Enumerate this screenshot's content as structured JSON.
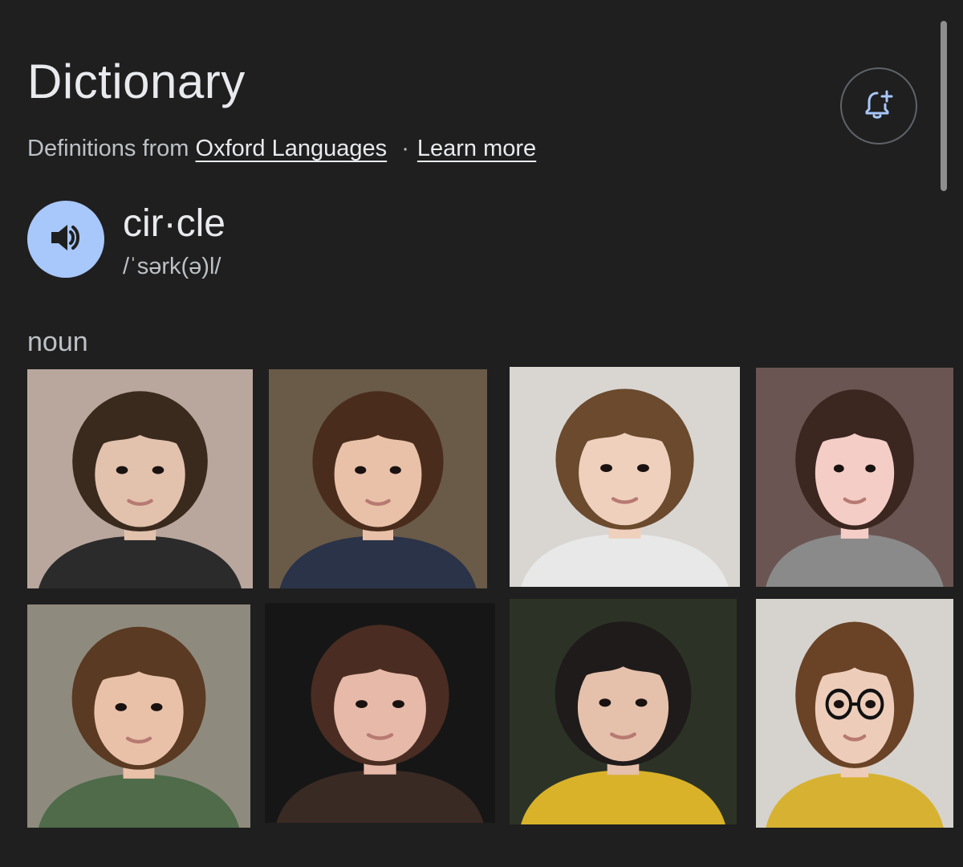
{
  "header": {
    "title": "Dictionary",
    "source_prefix": "Definitions from",
    "source_link": "Oxford Languages",
    "separator": "·",
    "learn_more": "Learn more",
    "alert_icon": "bell-plus-icon"
  },
  "entry": {
    "headword": "cir·cle",
    "phonetic": "/ˈsərk(ə)l/",
    "speaker_icon": "speaker-icon",
    "part_of_speech": "noun"
  },
  "colors": {
    "background": "#1f1f1f",
    "accent_blue": "#a8c7fa",
    "text_primary": "#e8eaed",
    "text_secondary": "#bdc1c6"
  },
  "photos": [
    {
      "bg": "#b9a79d",
      "hair": "#3a2a1e",
      "skin": "#e2c2ad",
      "shirt": "#2b2b2b",
      "glasses": false
    },
    {
      "bg": "#6a5a48",
      "hair": "#4a2c1c",
      "skin": "#e8c1a8",
      "shirt": "#2a3348",
      "glasses": false
    },
    {
      "bg": "#d9d6d2",
      "hair": "#6b4a2e",
      "skin": "#efd0bd",
      "shirt": "#e8e8e8",
      "glasses": false
    },
    {
      "bg": "#6a5552",
      "hair": "#3b2620",
      "skin": "#f3cdc6",
      "shirt": "#8a8a8a",
      "glasses": false
    },
    {
      "bg": "#8f8a7e",
      "hair": "#5a3a22",
      "skin": "#e9c1a9",
      "shirt": "#4f6b4a",
      "glasses": false
    },
    {
      "bg": "#161616",
      "hair": "#4a2c22",
      "skin": "#e6b9a8",
      "shirt": "#3a2a24",
      "glasses": false
    },
    {
      "bg": "#2c3326",
      "hair": "#1f1b1a",
      "skin": "#e5c0ab",
      "shirt": "#d9b22a",
      "glasses": false
    },
    {
      "bg": "#d6d3cf",
      "hair": "#6a4226",
      "skin": "#edcdb9",
      "shirt": "#d7b232",
      "glasses": true
    }
  ]
}
